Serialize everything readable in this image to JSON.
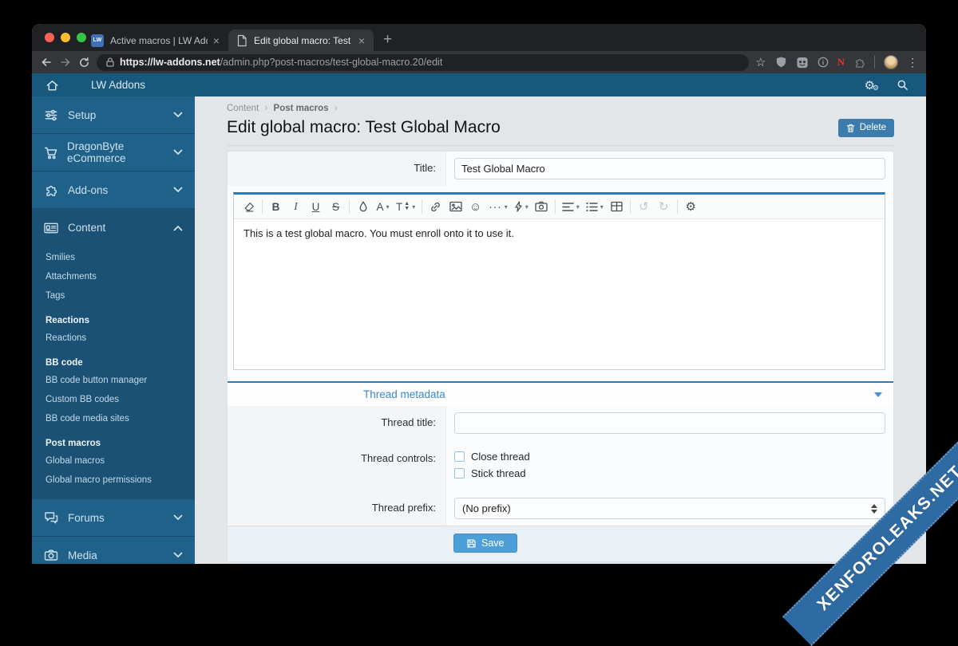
{
  "browser": {
    "tab1": {
      "title": "Active macros | LW Addons"
    },
    "tab2": {
      "title": "Edit global macro: Test Global"
    },
    "url_host": "https://lw-addons.net",
    "url_path": "/admin.php?post-macros/test-global-macro.20/edit",
    "favicon_text": "LW"
  },
  "icons": {
    "close_tab": "×",
    "new_tab": "+",
    "star": "☆",
    "menu_dots": "⋮",
    "ellipsis": "···",
    "undo": "↺",
    "redo": "↻",
    "gear": "⚙",
    "smiley": "☺",
    "extension_n": "N",
    "caret": "▾"
  },
  "header": {
    "title": "LW Addons"
  },
  "sidebar": {
    "items": [
      {
        "label": "Setup"
      },
      {
        "label": "DragonByte eCommerce"
      },
      {
        "label": "Add-ons"
      },
      {
        "label": "Content"
      },
      {
        "label": "Forums"
      },
      {
        "label": "Media"
      }
    ],
    "content_menu": [
      {
        "label": "Smilies"
      },
      {
        "label": "Attachments"
      },
      {
        "label": "Tags"
      },
      {
        "label": "Reactions",
        "header": true
      },
      {
        "label": "Reactions"
      },
      {
        "label": "BB code",
        "header": true
      },
      {
        "label": "BB code button manager"
      },
      {
        "label": "Custom BB codes"
      },
      {
        "label": "BB code media sites"
      },
      {
        "label": "Post macros",
        "header": true
      },
      {
        "label": "Global macros"
      },
      {
        "label": "Global macro permissions"
      }
    ]
  },
  "main": {
    "breadcrumb": {
      "item1": "Content",
      "item2": "Post macros",
      "sep": "›"
    },
    "page_title": "Edit global macro: Test Global Macro",
    "delete_button": "Delete",
    "form": {
      "title_label": "Title:",
      "title_value": "Test Global Macro",
      "editor": {
        "text": "This is a test global macro. You must enroll onto it to use it.",
        "bold": "B",
        "italic": "I",
        "underline": "U",
        "strike": "S",
        "font": "A",
        "size": "T"
      },
      "section_header": "Thread metadata",
      "thread_title_label": "Thread title:",
      "thread_controls_label": "Thread controls:",
      "close_thread_label": "Close thread",
      "stick_thread_label": "Stick thread",
      "thread_prefix_label": "Thread prefix:",
      "thread_prefix_value": "(No prefix)",
      "save_button": "Save"
    }
  },
  "watermark": {
    "text": "XENFOROLEAKS.NET",
    "color": "#2e6ba3"
  },
  "colors": {
    "sidebar_blue": "#20618a",
    "header_blue": "#18587c",
    "accent_blue": "#2b7ab5",
    "save_blue": "#4c9fd8",
    "delete_blue": "#3c7cac",
    "tabstrip_dark": "#202124",
    "toolbar_dark": "#35363a"
  }
}
